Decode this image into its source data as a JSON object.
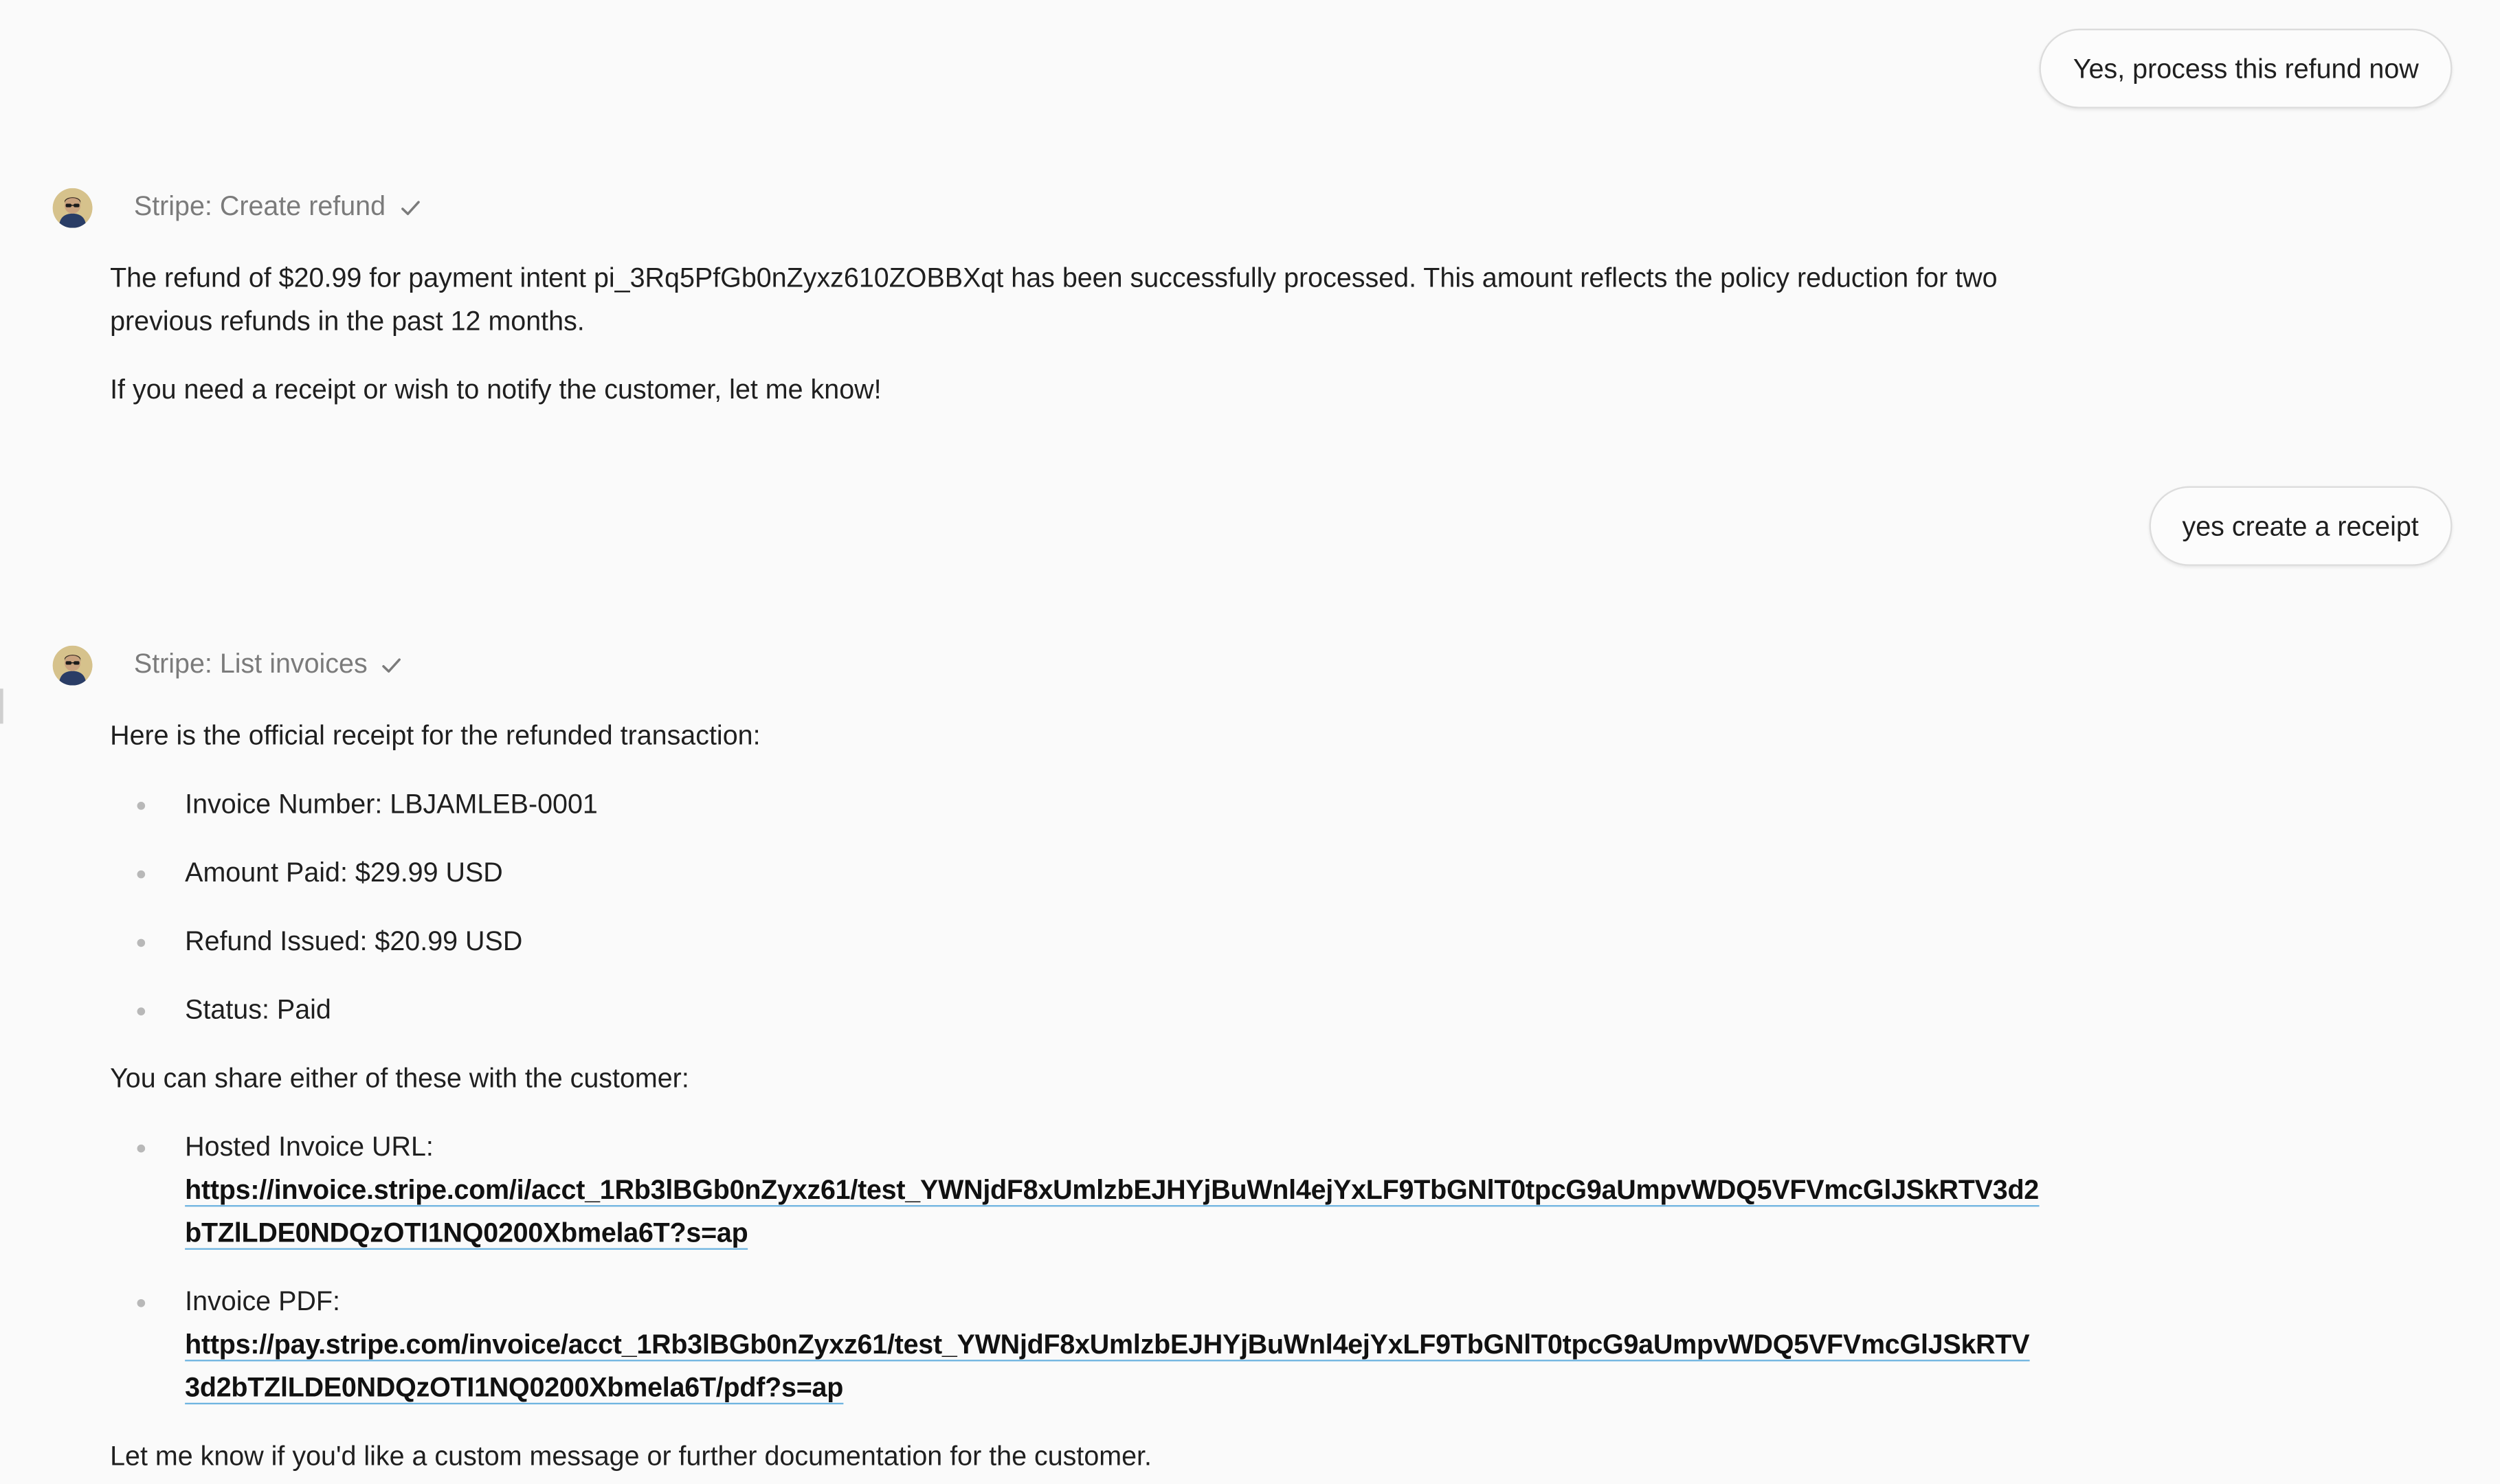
{
  "conversation": {
    "user_message_1": "Yes, process this refund now",
    "tool_call_1": {
      "label": "Stripe: Create refund",
      "status_icon": "check-icon"
    },
    "assistant_1": {
      "para_1": "The refund of $20.99 for payment intent pi_3Rq5PfGb0nZyxz610ZOBBXqt has been successfully processed. This amount reflects the policy reduction for two previous refunds in the past 12 months.",
      "para_2": "If you need a receipt or wish to notify the customer, let me know!"
    },
    "user_message_2": "yes create a receipt",
    "tool_call_2": {
      "label": "Stripe: List invoices",
      "status_icon": "check-icon"
    },
    "assistant_2": {
      "intro": "Here is the official receipt for the refunded transaction:",
      "receipt_items": [
        "Invoice Number: LBJAMLEB-0001",
        "Amount Paid: $29.99 USD",
        "Refund Issued: $20.99 USD",
        "Status: Paid"
      ],
      "share_intro": "You can share either of these with the customer:",
      "links": [
        {
          "label": "Hosted Invoice URL:",
          "url": "https://invoice.stripe.com/i/acct_1Rb3lBGb0nZyxz61/test_YWNjdF8xUmlzbEJHYjBuWnl4ejYxLF9TbGNlT0tpcG9aUmpvWDQ5VFVmcGlJSkRTV3d2bTZlLDE0NDQzOTI1NQ0200Xbmela6T?s=ap"
        },
        {
          "label": "Invoice PDF:",
          "url": "https://pay.stripe.com/invoice/acct_1Rb3lBGb0nZyxz61/test_YWNjdF8xUmlzbEJHYjBuWnl4ejYxLF9TbGNlT0tpcG9aUmpvWDQ5VFVmcGlJSkRTV3d2bTZlLDE0NDQzOTI1NQ0200Xbmela6T/pdf?s=ap"
        }
      ],
      "closing": "Let me know if you'd like a custom message or further documentation for the customer."
    }
  },
  "colors": {
    "background": "#fafafa",
    "link_underline": "#6fb4e0",
    "muted_text": "#7b7b7b",
    "bubble_border": "#dcdcdc"
  }
}
